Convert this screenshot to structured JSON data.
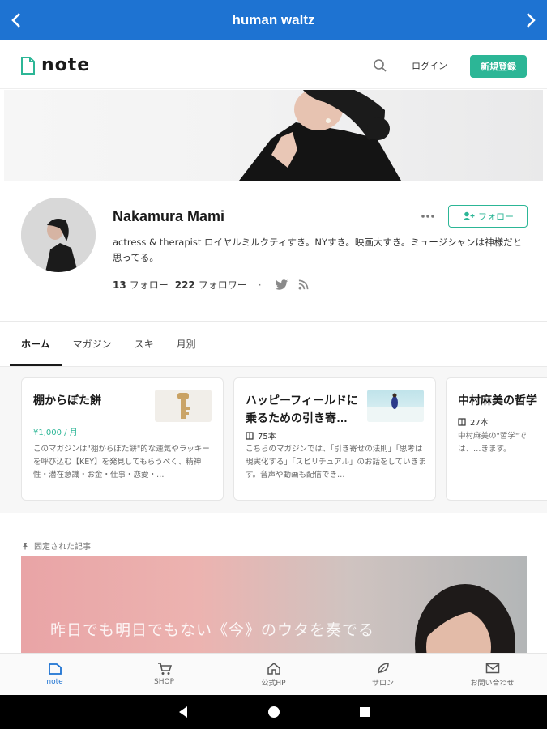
{
  "appbar": {
    "title": "human waltz"
  },
  "header": {
    "logo": "note",
    "login": "ログイン",
    "signup": "新規登録"
  },
  "profile": {
    "name": "Nakamura Mami",
    "follow_button": "フォロー",
    "bio": "actress & therapist ロイヤルミルクティすき。NYすき。映画大すき。ミュージシャンは神様だと思ってる。",
    "follow_count": "13",
    "follow_label": "フォロー",
    "follower_count": "222",
    "follower_label": "フォロワー"
  },
  "tabs": [
    "ホーム",
    "マガジン",
    "スキ",
    "月別"
  ],
  "magazines": [
    {
      "title": "棚からぼた餅",
      "price": "¥1,000 / 月",
      "desc": "このマガジンは\"棚からぼた餅\"的な運気やラッキーを呼び込む【KEY】を発見してもらうべく、精神性・潜在意識・お金・仕事・恋愛・…"
    },
    {
      "title": "ハッピーフィールドに乗るための引き寄…",
      "count": "75本",
      "desc": "こちらのマガジンでは、「引き寄せの法則」「思考は現実化する」「スピリチュアル」のお話をしていきます。音声や動画も配信でき…"
    },
    {
      "title": "中村麻美の哲学",
      "count": "27本",
      "desc": "中村麻美の\"哲学\"では、…きます。"
    }
  ],
  "pinned": {
    "label": "固定された記事",
    "caption": "昨日でも明日でもない《今》のウタを奏でる"
  },
  "bottomnav": [
    {
      "label": "note",
      "icon": "note-icon",
      "active": true
    },
    {
      "label": "SHOP",
      "icon": "cart-icon"
    },
    {
      "label": "公式HP",
      "icon": "home-icon"
    },
    {
      "label": "サロン",
      "icon": "leaf-icon"
    },
    {
      "label": "お問い合わせ",
      "icon": "mail-icon"
    }
  ],
  "colors": {
    "appbar": "#1e73d2",
    "accent": "#2cb696"
  }
}
